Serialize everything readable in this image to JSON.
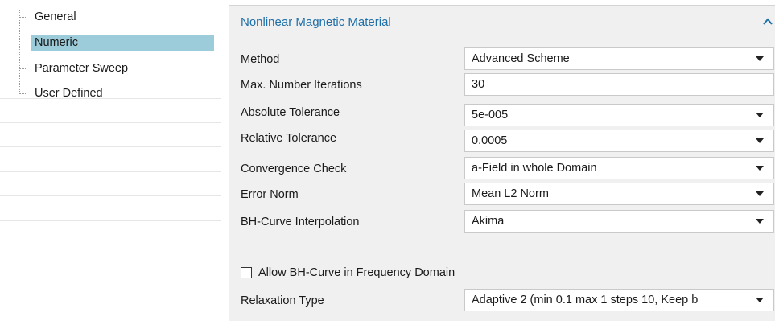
{
  "tree": {
    "items": [
      {
        "label": "General",
        "selected": false
      },
      {
        "label": "Numeric",
        "selected": true
      },
      {
        "label": "Parameter Sweep",
        "selected": false
      },
      {
        "label": "User Defined",
        "selected": false
      }
    ]
  },
  "panel": {
    "section_title": "Nonlinear Magnetic Material",
    "collapse_icon": "chevron-up-icon",
    "rows": [
      {
        "label": "Method",
        "value": "Advanced Scheme",
        "type": "dropdown"
      },
      {
        "label": "Max. Number Iterations",
        "value": "30",
        "type": "text"
      },
      {
        "label": "Absolute Tolerance",
        "value": "5e-005",
        "type": "dropdown"
      },
      {
        "label": "Relative Tolerance",
        "value": "0.0005",
        "type": "dropdown"
      },
      {
        "label": "Convergence Check",
        "value": "a-Field in whole Domain",
        "type": "dropdown"
      },
      {
        "label": "Error Norm",
        "value": "Mean L2 Norm",
        "type": "dropdown"
      },
      {
        "label": "BH-Curve Interpolation",
        "value": "Akima",
        "type": "dropdown"
      }
    ],
    "checkbox": {
      "label": "Allow BH-Curve in Frequency Domain",
      "checked": false
    },
    "relaxation": {
      "label": "Relaxation Type",
      "value": "Adaptive 2 (min 0.1 max 1 steps 10, Keep b",
      "type": "dropdown"
    }
  },
  "colors": {
    "selection": "#9ccbd9",
    "section_title": "#1f6fa8",
    "panel_bg": "#f0f0f0"
  }
}
